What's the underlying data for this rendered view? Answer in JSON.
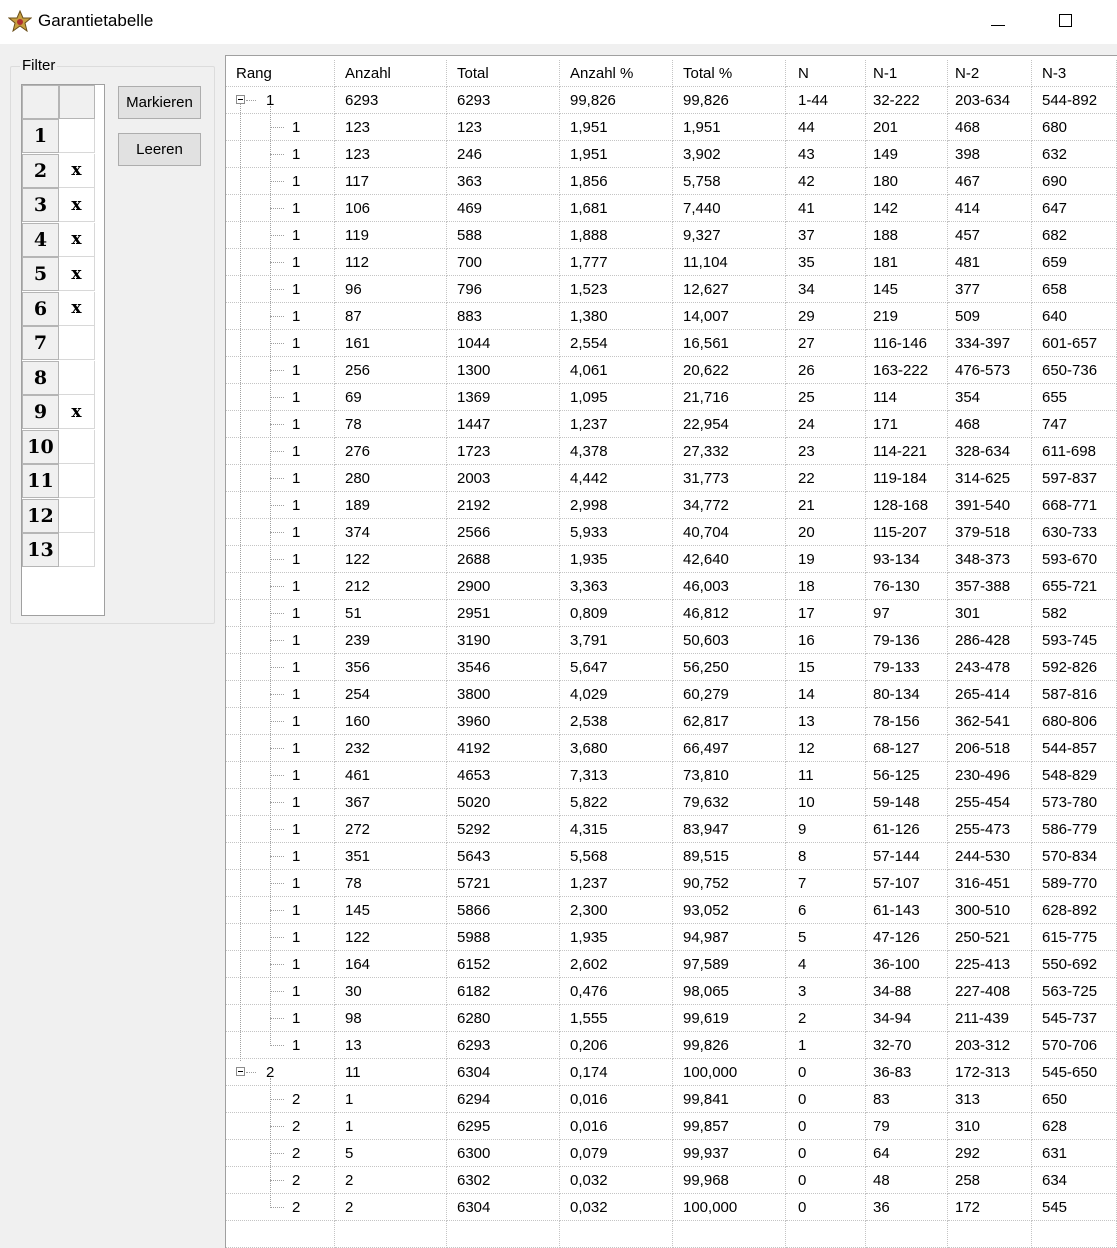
{
  "window": {
    "title": "Garantietabelle"
  },
  "filter": {
    "legend": "Filter",
    "mark_label": "Markieren",
    "clear_label": "Leeren",
    "rows": [
      {
        "label": "1",
        "value": ""
      },
      {
        "label": "2",
        "value": "x"
      },
      {
        "label": "3",
        "value": "x"
      },
      {
        "label": "4",
        "value": "x"
      },
      {
        "label": "5",
        "value": "x"
      },
      {
        "label": "6",
        "value": "x"
      },
      {
        "label": "7",
        "value": ""
      },
      {
        "label": "8",
        "value": ""
      },
      {
        "label": "9",
        "value": "x"
      },
      {
        "label": "10",
        "value": ""
      },
      {
        "label": "11",
        "value": ""
      },
      {
        "label": "12",
        "value": ""
      },
      {
        "label": "13",
        "value": ""
      }
    ]
  },
  "table": {
    "columns": [
      "Rang",
      "Anzahl",
      "Total",
      "Anzahl %",
      "Total %",
      "N",
      "N-1",
      "N-2",
      "N-3"
    ],
    "groups": [
      {
        "row": [
          "1",
          "6293",
          "6293",
          "99,826",
          "99,826",
          "1-44",
          "32-222",
          "203-634",
          "544-892"
        ],
        "children": [
          [
            "1",
            "123",
            "123",
            "1,951",
            "1,951",
            "44",
            "201",
            "468",
            "680"
          ],
          [
            "1",
            "123",
            "246",
            "1,951",
            "3,902",
            "43",
            "149",
            "398",
            "632"
          ],
          [
            "1",
            "117",
            "363",
            "1,856",
            "5,758",
            "42",
            "180",
            "467",
            "690"
          ],
          [
            "1",
            "106",
            "469",
            "1,681",
            "7,440",
            "41",
            "142",
            "414",
            "647"
          ],
          [
            "1",
            "119",
            "588",
            "1,888",
            "9,327",
            "37",
            "188",
            "457",
            "682"
          ],
          [
            "1",
            "112",
            "700",
            "1,777",
            "11,104",
            "35",
            "181",
            "481",
            "659"
          ],
          [
            "1",
            "96",
            "796",
            "1,523",
            "12,627",
            "34",
            "145",
            "377",
            "658"
          ],
          [
            "1",
            "87",
            "883",
            "1,380",
            "14,007",
            "29",
            "219",
            "509",
            "640"
          ],
          [
            "1",
            "161",
            "1044",
            "2,554",
            "16,561",
            "27",
            "116-146",
            "334-397",
            "601-657"
          ],
          [
            "1",
            "256",
            "1300",
            "4,061",
            "20,622",
            "26",
            "163-222",
            "476-573",
            "650-736"
          ],
          [
            "1",
            "69",
            "1369",
            "1,095",
            "21,716",
            "25",
            "114",
            "354",
            "655"
          ],
          [
            "1",
            "78",
            "1447",
            "1,237",
            "22,954",
            "24",
            "171",
            "468",
            "747"
          ],
          [
            "1",
            "276",
            "1723",
            "4,378",
            "27,332",
            "23",
            "114-221",
            "328-634",
            "611-698"
          ],
          [
            "1",
            "280",
            "2003",
            "4,442",
            "31,773",
            "22",
            "119-184",
            "314-625",
            "597-837"
          ],
          [
            "1",
            "189",
            "2192",
            "2,998",
            "34,772",
            "21",
            "128-168",
            "391-540",
            "668-771"
          ],
          [
            "1",
            "374",
            "2566",
            "5,933",
            "40,704",
            "20",
            "115-207",
            "379-518",
            "630-733"
          ],
          [
            "1",
            "122",
            "2688",
            "1,935",
            "42,640",
            "19",
            "93-134",
            "348-373",
            "593-670"
          ],
          [
            "1",
            "212",
            "2900",
            "3,363",
            "46,003",
            "18",
            "76-130",
            "357-388",
            "655-721"
          ],
          [
            "1",
            "51",
            "2951",
            "0,809",
            "46,812",
            "17",
            "97",
            "301",
            "582"
          ],
          [
            "1",
            "239",
            "3190",
            "3,791",
            "50,603",
            "16",
            "79-136",
            "286-428",
            "593-745"
          ],
          [
            "1",
            "356",
            "3546",
            "5,647",
            "56,250",
            "15",
            "79-133",
            "243-478",
            "592-826"
          ],
          [
            "1",
            "254",
            "3800",
            "4,029",
            "60,279",
            "14",
            "80-134",
            "265-414",
            "587-816"
          ],
          [
            "1",
            "160",
            "3960",
            "2,538",
            "62,817",
            "13",
            "78-156",
            "362-541",
            "680-806"
          ],
          [
            "1",
            "232",
            "4192",
            "3,680",
            "66,497",
            "12",
            "68-127",
            "206-518",
            "544-857"
          ],
          [
            "1",
            "461",
            "4653",
            "7,313",
            "73,810",
            "11",
            "56-125",
            "230-496",
            "548-829"
          ],
          [
            "1",
            "367",
            "5020",
            "5,822",
            "79,632",
            "10",
            "59-148",
            "255-454",
            "573-780"
          ],
          [
            "1",
            "272",
            "5292",
            "4,315",
            "83,947",
            "9",
            "61-126",
            "255-473",
            "586-779"
          ],
          [
            "1",
            "351",
            "5643",
            "5,568",
            "89,515",
            "8",
            "57-144",
            "244-530",
            "570-834"
          ],
          [
            "1",
            "78",
            "5721",
            "1,237",
            "90,752",
            "7",
            "57-107",
            "316-451",
            "589-770"
          ],
          [
            "1",
            "145",
            "5866",
            "2,300",
            "93,052",
            "6",
            "61-143",
            "300-510",
            "628-892"
          ],
          [
            "1",
            "122",
            "5988",
            "1,935",
            "94,987",
            "5",
            "47-126",
            "250-521",
            "615-775"
          ],
          [
            "1",
            "164",
            "6152",
            "2,602",
            "97,589",
            "4",
            "36-100",
            "225-413",
            "550-692"
          ],
          [
            "1",
            "30",
            "6182",
            "0,476",
            "98,065",
            "3",
            "34-88",
            "227-408",
            "563-725"
          ],
          [
            "1",
            "98",
            "6280",
            "1,555",
            "99,619",
            "2",
            "34-94",
            "211-439",
            "545-737"
          ],
          [
            "1",
            "13",
            "6293",
            "0,206",
            "99,826",
            "1",
            "32-70",
            "203-312",
            "570-706"
          ]
        ]
      },
      {
        "row": [
          "2",
          "11",
          "6304",
          "0,174",
          "100,000",
          "0",
          "36-83",
          "172-313",
          "545-650"
        ],
        "children": [
          [
            "2",
            "1",
            "6294",
            "0,016",
            "99,841",
            "0",
            "83",
            "313",
            "650"
          ],
          [
            "2",
            "1",
            "6295",
            "0,016",
            "99,857",
            "0",
            "79",
            "310",
            "628"
          ],
          [
            "2",
            "5",
            "6300",
            "0,079",
            "99,937",
            "0",
            "64",
            "292",
            "631"
          ],
          [
            "2",
            "2",
            "6302",
            "0,032",
            "99,968",
            "0",
            "48",
            "258",
            "634"
          ],
          [
            "2",
            "2",
            "6304",
            "0,032",
            "100,000",
            "0",
            "36",
            "172",
            "545"
          ]
        ]
      }
    ]
  }
}
